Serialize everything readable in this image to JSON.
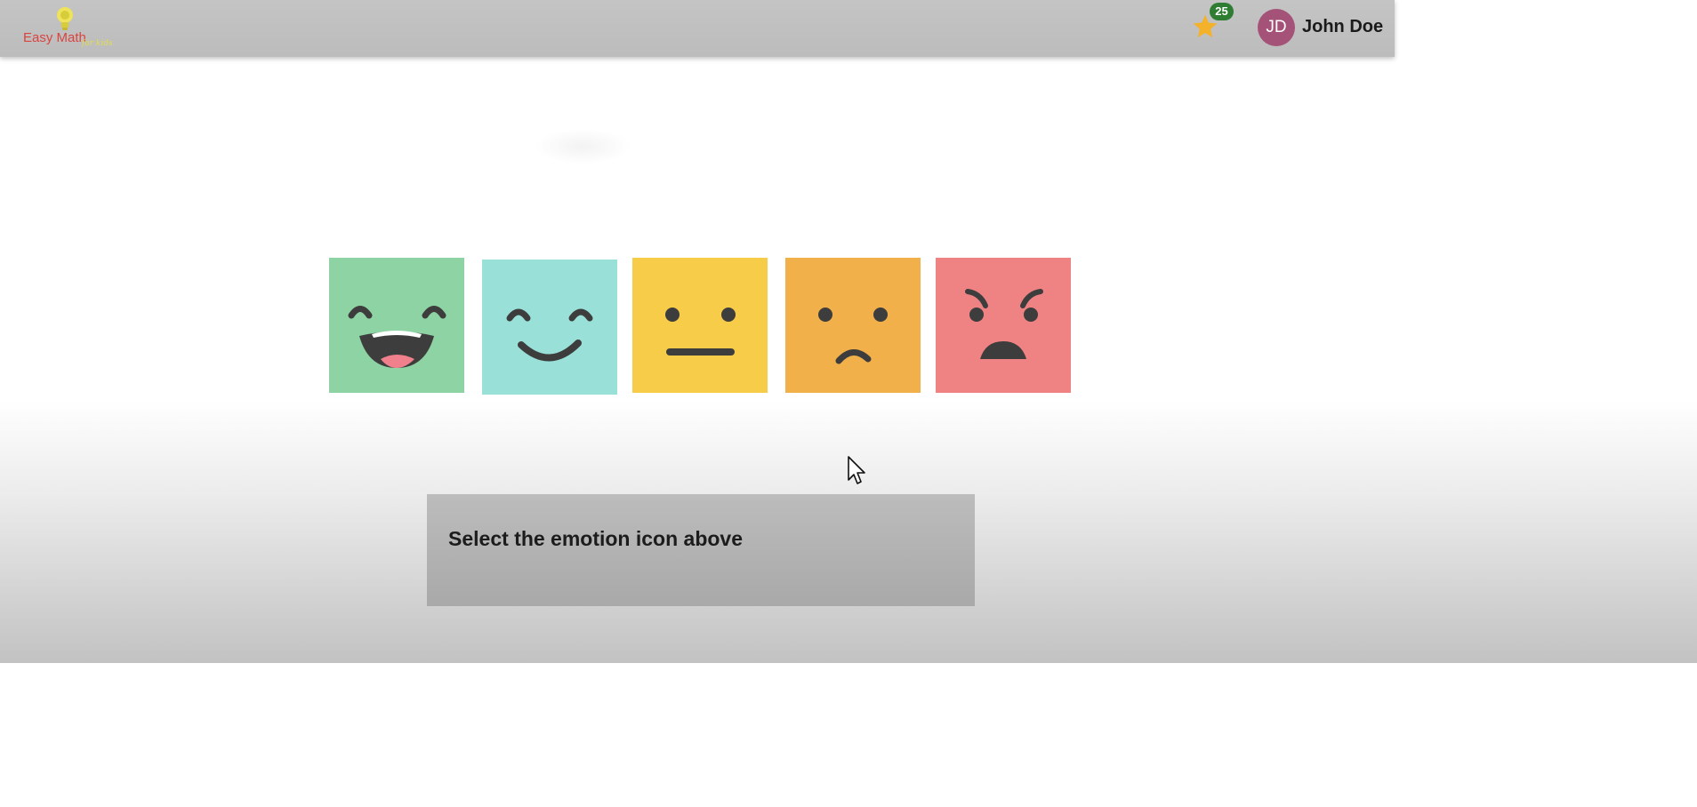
{
  "app": {
    "logo_text": "Easy Math",
    "logo_subtext": "for kids",
    "stars_count": "25",
    "user_initials": "JD",
    "user_name": "John Doe"
  },
  "emotions": [
    {
      "name": "laughing",
      "color": "#8ed3a4"
    },
    {
      "name": "smiling",
      "color": "#98e0d8"
    },
    {
      "name": "neutral",
      "color": "#f6cc48"
    },
    {
      "name": "sad",
      "color": "#f1b04a"
    },
    {
      "name": "angry",
      "color": "#ef8282"
    }
  ],
  "prompt": {
    "text": "Select the emotion icon above"
  },
  "colors": {
    "badge": "#2e7d32",
    "avatar": "#a55278",
    "star": "#f3b229",
    "logo": "#d9443f"
  }
}
